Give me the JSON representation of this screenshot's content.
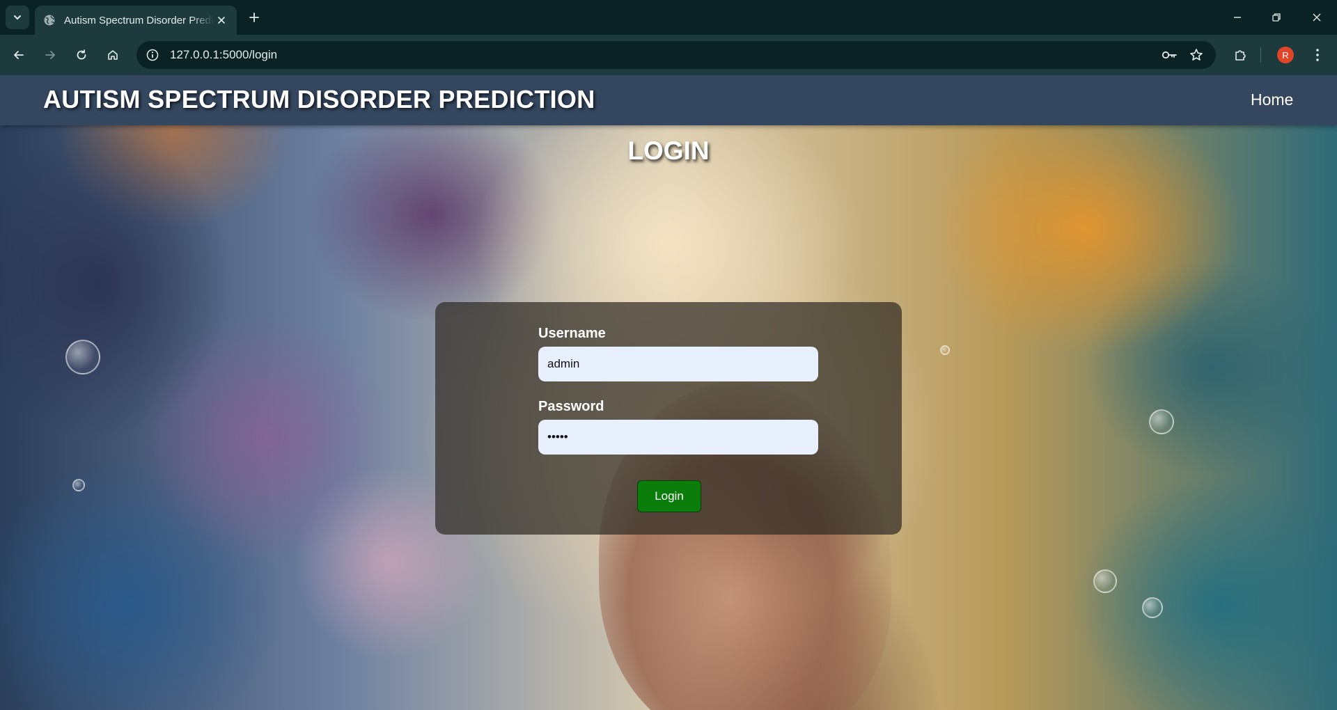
{
  "browser": {
    "tab_title": "Autism Spectrum Disorder Prediction",
    "url": "127.0.0.1:5000/login",
    "profile_initial": "R",
    "icons": {
      "tab_search": "chevron-down-icon",
      "favicon": "globe-icon",
      "close": "close-icon",
      "new_tab": "plus-icon",
      "back": "arrow-left-icon",
      "forward": "arrow-right-icon",
      "reload": "reload-icon",
      "home": "home-icon",
      "site_info": "info-icon",
      "passwords": "key-icon",
      "bookmark": "star-icon",
      "extensions": "puzzle-icon",
      "menu": "kebab-menu-icon"
    }
  },
  "navbar": {
    "brand": "AUTISM SPECTRUM DISORDER PREDICTION",
    "home_link": "Home",
    "background_color": "#34475f"
  },
  "page": {
    "heading": "LOGIN"
  },
  "login_form": {
    "username_label": "Username",
    "username_value": "admin",
    "password_label": "Password",
    "password_value": "admin",
    "submit_label": "Login",
    "submit_color": "#0a7d0a"
  }
}
